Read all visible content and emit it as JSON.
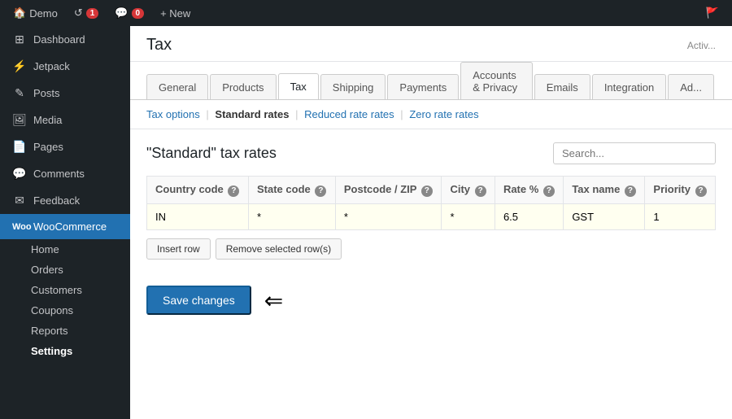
{
  "adminBar": {
    "items": [
      {
        "label": "Demo",
        "icon": "🏠"
      },
      {
        "label": "1",
        "badge": true,
        "icon": "↺"
      },
      {
        "label": "0",
        "badge": true,
        "icon": "💬"
      },
      {
        "label": "+ New",
        "icon": ""
      }
    ]
  },
  "sidebar": {
    "items": [
      {
        "label": "Dashboard",
        "icon": "⚫",
        "name": "dashboard"
      },
      {
        "label": "Jetpack",
        "icon": "⚡",
        "name": "jetpack"
      },
      {
        "label": "Posts",
        "icon": "📝",
        "name": "posts"
      },
      {
        "label": "Media",
        "icon": "🖼",
        "name": "media"
      },
      {
        "label": "Pages",
        "icon": "📄",
        "name": "pages"
      },
      {
        "label": "Comments",
        "icon": "💬",
        "name": "comments"
      },
      {
        "label": "Feedback",
        "icon": "✉",
        "name": "feedback"
      },
      {
        "label": "WooCommerce",
        "icon": "🛒",
        "name": "woocommerce",
        "active": true
      }
    ],
    "subItems": [
      {
        "label": "Home",
        "name": "woo-home"
      },
      {
        "label": "Orders",
        "name": "woo-orders"
      },
      {
        "label": "Customers",
        "name": "woo-customers"
      },
      {
        "label": "Coupons",
        "name": "woo-coupons"
      },
      {
        "label": "Reports",
        "name": "woo-reports"
      },
      {
        "label": "Settings",
        "name": "woo-settings",
        "active": true
      }
    ]
  },
  "header": {
    "title": "Tax",
    "activeBadge": "Activ..."
  },
  "tabs": [
    {
      "label": "General",
      "name": "tab-general"
    },
    {
      "label": "Products",
      "name": "tab-products"
    },
    {
      "label": "Tax",
      "name": "tab-tax",
      "active": true
    },
    {
      "label": "Shipping",
      "name": "tab-shipping"
    },
    {
      "label": "Payments",
      "name": "tab-payments"
    },
    {
      "label": "Accounts & Privacy",
      "name": "tab-accounts"
    },
    {
      "label": "Emails",
      "name": "tab-emails"
    },
    {
      "label": "Integration",
      "name": "tab-integration"
    },
    {
      "label": "Ad...",
      "name": "tab-advanced"
    }
  ],
  "subNav": [
    {
      "label": "Tax options",
      "href": "#",
      "active": false
    },
    {
      "label": "Standard rates",
      "href": "#",
      "active": true
    },
    {
      "label": "Reduced rate rates",
      "href": "#",
      "active": false
    },
    {
      "label": "Zero rate rates",
      "href": "#",
      "active": false
    }
  ],
  "section": {
    "heading": "\"Standard\" tax rates",
    "searchPlaceholder": "Search...",
    "table": {
      "columns": [
        {
          "label": "Country code",
          "help": true
        },
        {
          "label": "State code",
          "help": true
        },
        {
          "label": "Postcode / ZIP",
          "help": true
        },
        {
          "label": "City",
          "help": true
        },
        {
          "label": "Rate %",
          "help": true
        },
        {
          "label": "Tax name",
          "help": true
        },
        {
          "label": "Priority",
          "help": true
        }
      ],
      "rows": [
        {
          "country_code": "IN",
          "state_code": "*",
          "postcode": "*",
          "city": "*",
          "rate": "6.5",
          "tax_name": "GST",
          "priority": "1"
        }
      ]
    },
    "insertRowBtn": "Insert row",
    "removeRowBtn": "Remove selected row(s)"
  },
  "footer": {
    "saveBtn": "Save changes"
  }
}
